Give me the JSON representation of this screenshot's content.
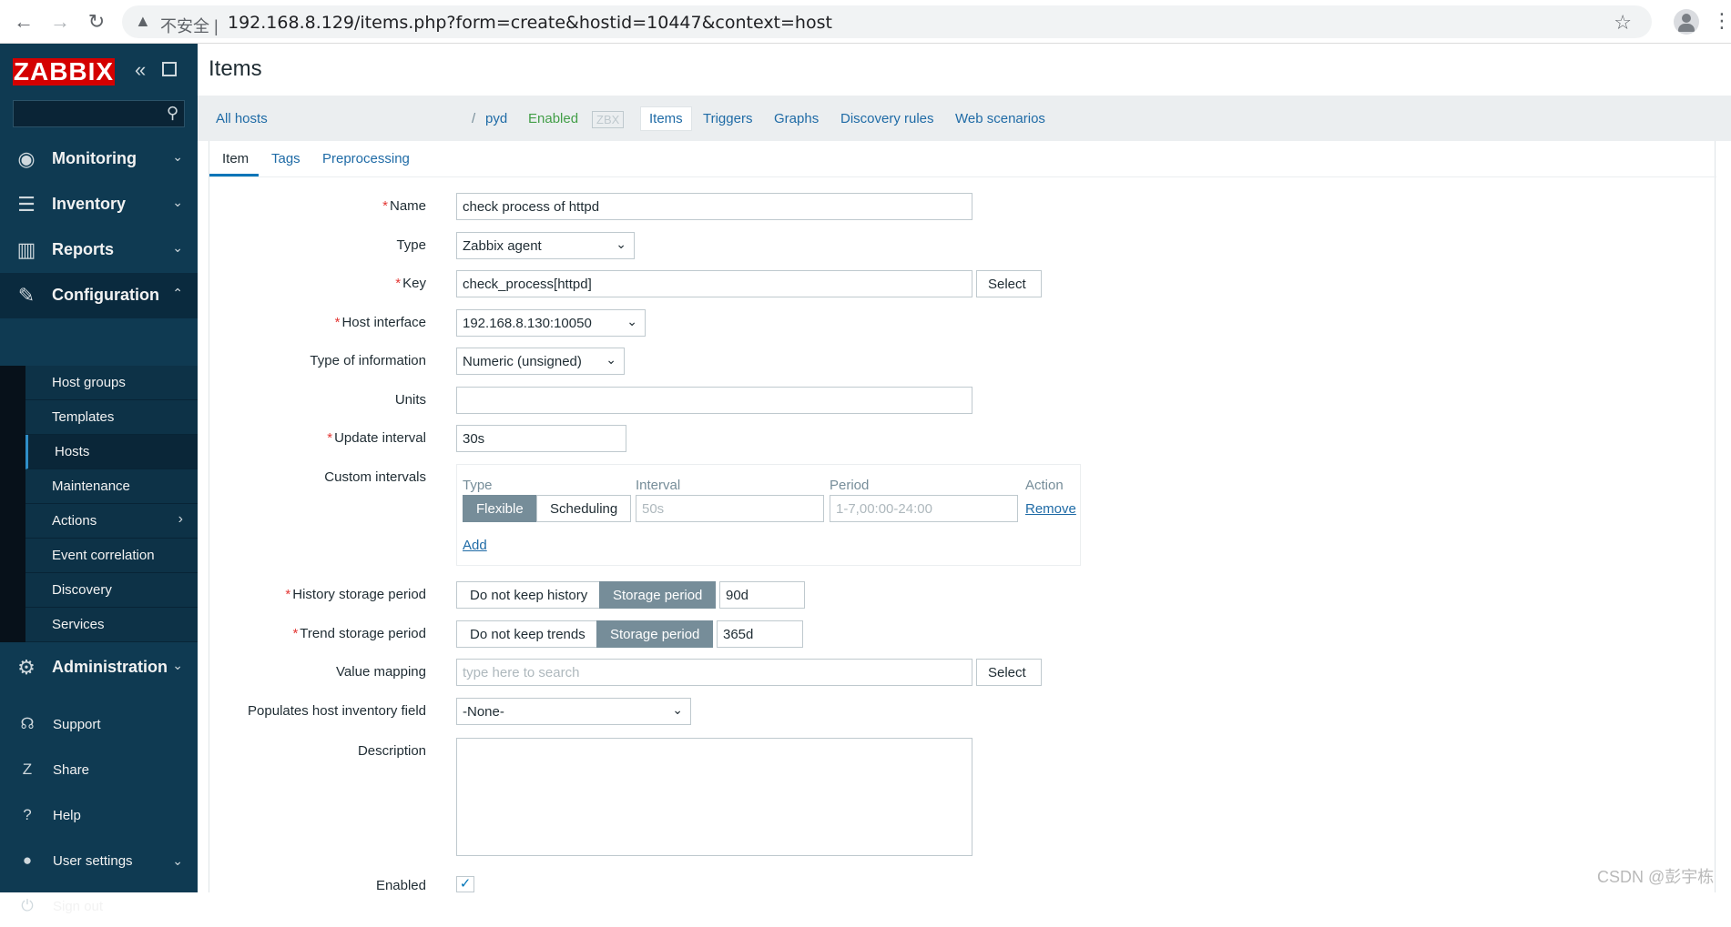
{
  "browser": {
    "back_icon": "←",
    "forward_icon": "→",
    "reload_icon": "↻",
    "insecure_icon": "▲",
    "insecure_label": "不安全 |",
    "url": "192.168.8.129/items.php?form=create&hostid=10447&context=host",
    "star_icon": "☆",
    "menu_icon": "⋮"
  },
  "sidebar": {
    "logo": "ZABBIX",
    "collapse_icon": "«",
    "search_icon": "⚲",
    "menu": [
      {
        "label": "Monitoring",
        "icon": "◉",
        "arrow": "⌄"
      },
      {
        "label": "Inventory",
        "icon": "☰",
        "arrow": "⌄"
      },
      {
        "label": "Reports",
        "icon": "▥",
        "arrow": "⌄"
      },
      {
        "label": "Configuration",
        "icon": "✎",
        "arrow": "⌃"
      },
      {
        "label": "Administration",
        "icon": "⚙",
        "arrow": "⌄"
      }
    ],
    "submenu": [
      {
        "label": "Host groups"
      },
      {
        "label": "Templates"
      },
      {
        "label": "Hosts"
      },
      {
        "label": "Maintenance"
      },
      {
        "label": "Actions",
        "arrow": "›"
      },
      {
        "label": "Event correlation"
      },
      {
        "label": "Discovery"
      },
      {
        "label": "Services"
      }
    ],
    "bottom": [
      {
        "label": "Support",
        "icon": "☊"
      },
      {
        "label": "Share",
        "icon": "Z"
      },
      {
        "label": "Help",
        "icon": "?"
      },
      {
        "label": "User settings",
        "icon": "●",
        "arrow": "⌄"
      },
      {
        "label": "Sign out",
        "icon": "⏻"
      }
    ]
  },
  "header": {
    "title": "Items"
  },
  "host_nav": {
    "all_hosts": "All hosts",
    "separator": "/",
    "host": "pyd",
    "status": "Enabled",
    "zbx": "ZBX",
    "tabs": [
      "Items",
      "Triggers",
      "Graphs",
      "Discovery rules",
      "Web scenarios"
    ]
  },
  "form_tabs": [
    "Item",
    "Tags",
    "Preprocessing"
  ],
  "form": {
    "name": {
      "label": "Name",
      "value": "check process of httpd"
    },
    "type": {
      "label": "Type",
      "value": "Zabbix agent"
    },
    "key": {
      "label": "Key",
      "value": "check_process[httpd]",
      "button": "Select"
    },
    "host_interface": {
      "label": "Host interface",
      "value": "192.168.8.130:10050"
    },
    "type_of_information": {
      "label": "Type of information",
      "value": "Numeric (unsigned)"
    },
    "units": {
      "label": "Units",
      "value": ""
    },
    "update_interval": {
      "label": "Update interval",
      "value": "30s"
    },
    "custom_intervals": {
      "label": "Custom intervals",
      "headers": [
        "Type",
        "Interval",
        "Period",
        "Action"
      ],
      "type_options": [
        "Flexible",
        "Scheduling"
      ],
      "interval_placeholder": "50s",
      "period_placeholder": "1-7,00:00-24:00",
      "remove": "Remove",
      "add": "Add"
    },
    "history": {
      "label": "History storage period",
      "options": [
        "Do not keep history",
        "Storage period"
      ],
      "value": "90d"
    },
    "trend": {
      "label": "Trend storage period",
      "options": [
        "Do not keep trends",
        "Storage period"
      ],
      "value": "365d"
    },
    "value_mapping": {
      "label": "Value mapping",
      "placeholder": "type here to search",
      "button": "Select"
    },
    "inventory_field": {
      "label": "Populates host inventory field",
      "value": "-None-"
    },
    "description": {
      "label": "Description",
      "value": ""
    },
    "enabled": {
      "label": "Enabled",
      "checked": true
    }
  },
  "watermark": "CSDN @彭宇栋"
}
